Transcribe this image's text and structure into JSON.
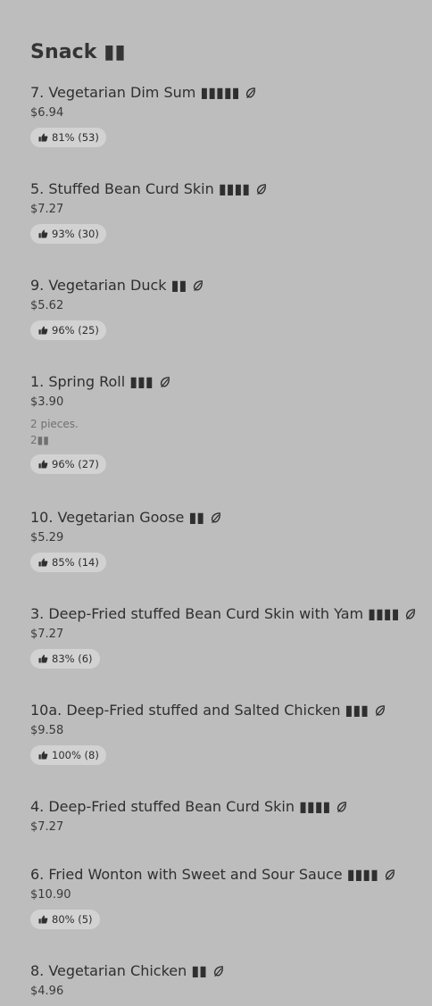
{
  "section": {
    "title": "Snack ▮▮"
  },
  "items": [
    {
      "title": "7. Vegetarian Dim Sum ▮▮▮▮▮",
      "price": "$6.94",
      "rating": "81% (53)"
    },
    {
      "title": "5. Stuffed Bean Curd Skin ▮▮▮▮",
      "price": "$7.27",
      "rating": "93% (30)"
    },
    {
      "title": "9. Vegetarian Duck ▮▮",
      "price": "$5.62",
      "rating": "96% (25)"
    },
    {
      "title": "1. Spring Roll ▮▮▮",
      "price": "$3.90",
      "desc1": "2 pieces.",
      "desc2": "2▮▮",
      "rating": "96% (27)"
    },
    {
      "title": "10. Vegetarian Goose ▮▮",
      "price": "$5.29",
      "rating": "85% (14)"
    },
    {
      "title": "3. Deep-Fried stuffed Bean Curd Skin with Yam ▮▮▮▮",
      "price": "$7.27",
      "rating": "83% (6)"
    },
    {
      "title": "10a. Deep-Fried stuffed and Salted Chicken ▮▮▮",
      "price": "$9.58",
      "rating": "100% (8)"
    },
    {
      "title": "4. Deep-Fried stuffed Bean Curd Skin ▮▮▮▮",
      "price": "$7.27"
    },
    {
      "title": "6. Fried Wonton with Sweet and Sour Sauce ▮▮▮▮",
      "price": "$10.90",
      "rating": "80% (5)"
    },
    {
      "title": "8. Vegetarian Chicken ▮▮",
      "price": "$4.96"
    }
  ],
  "icons": {
    "vegetarian": "leaf-icon",
    "rating": "thumbs-up-icon"
  },
  "colors": {
    "background": "#bdbdbd",
    "badge": "#d2d2d2",
    "text": "#2f2f2f",
    "muted": "#707070"
  }
}
